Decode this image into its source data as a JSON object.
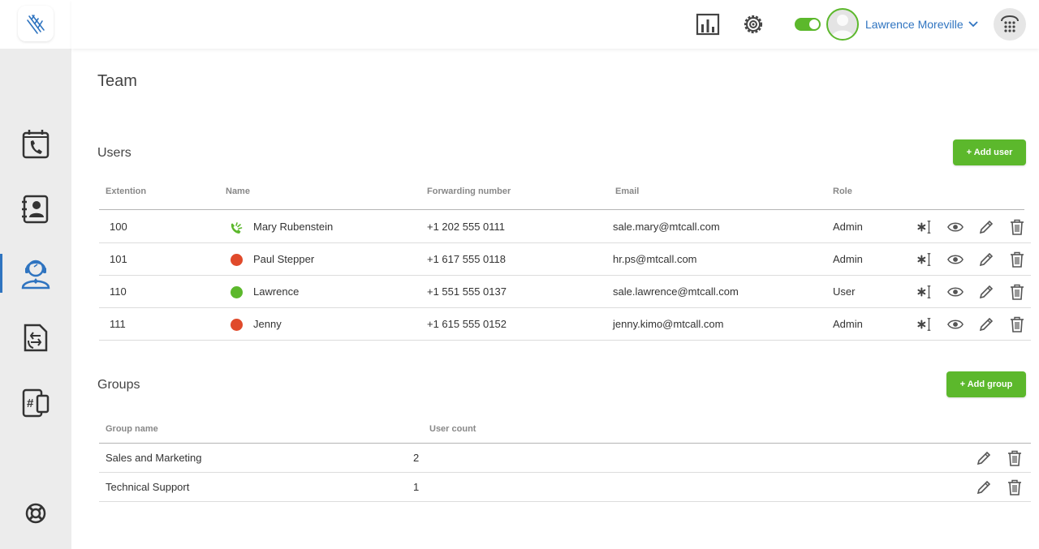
{
  "app": {
    "brand_color": "#2f74c0",
    "accent_color": "#5cb82c",
    "danger_color": "#e04a2b"
  },
  "topbar": {
    "status_toggle_on": true,
    "user_name": "Lawrence Moreville"
  },
  "sidebar": {
    "items": [
      {
        "icon": "call-log-icon",
        "active": false
      },
      {
        "icon": "contacts-icon",
        "active": false
      },
      {
        "icon": "team-agent-icon",
        "active": true
      },
      {
        "icon": "call-routing-icon",
        "active": false
      },
      {
        "icon": "numbers-icon",
        "active": false
      }
    ],
    "help_icon": "lifebuoy-icon"
  },
  "page": {
    "title": "Team"
  },
  "users": {
    "title": "Users",
    "add_label": "+ Add user",
    "columns": {
      "extension": "Extention",
      "name": "Name",
      "forwarding": "Forwarding number",
      "email": "Email",
      "role": "Role"
    },
    "rows": [
      {
        "extension": "100",
        "name": "Mary Rubenstein",
        "status": "ringing",
        "forwarding": "+1 202 555 0111",
        "email": "sale.mary@mtcall.com",
        "role": "Admin"
      },
      {
        "extension": "101",
        "name": "Paul Stepper",
        "status": "busy",
        "forwarding": "+1 617 555 0118",
        "email": "hr.ps@mtcall.com",
        "role": "Admin"
      },
      {
        "extension": "110",
        "name": "Lawrence",
        "status": "available",
        "forwarding": "+1 551 555 0137",
        "email": "sale.lawrence@mtcall.com",
        "role": "User"
      },
      {
        "extension": "111",
        "name": "Jenny",
        "status": "busy",
        "forwarding": "+1 615 555 0152",
        "email": "jenny.kimo@mtcall.com",
        "role": "Admin"
      }
    ]
  },
  "groups": {
    "title": "Groups",
    "add_label": "+ Add group",
    "columns": {
      "name": "Group name",
      "count": "User count"
    },
    "rows": [
      {
        "name": "Sales and Marketing",
        "count": "2"
      },
      {
        "name": "Technical Support",
        "count": "1"
      }
    ]
  }
}
